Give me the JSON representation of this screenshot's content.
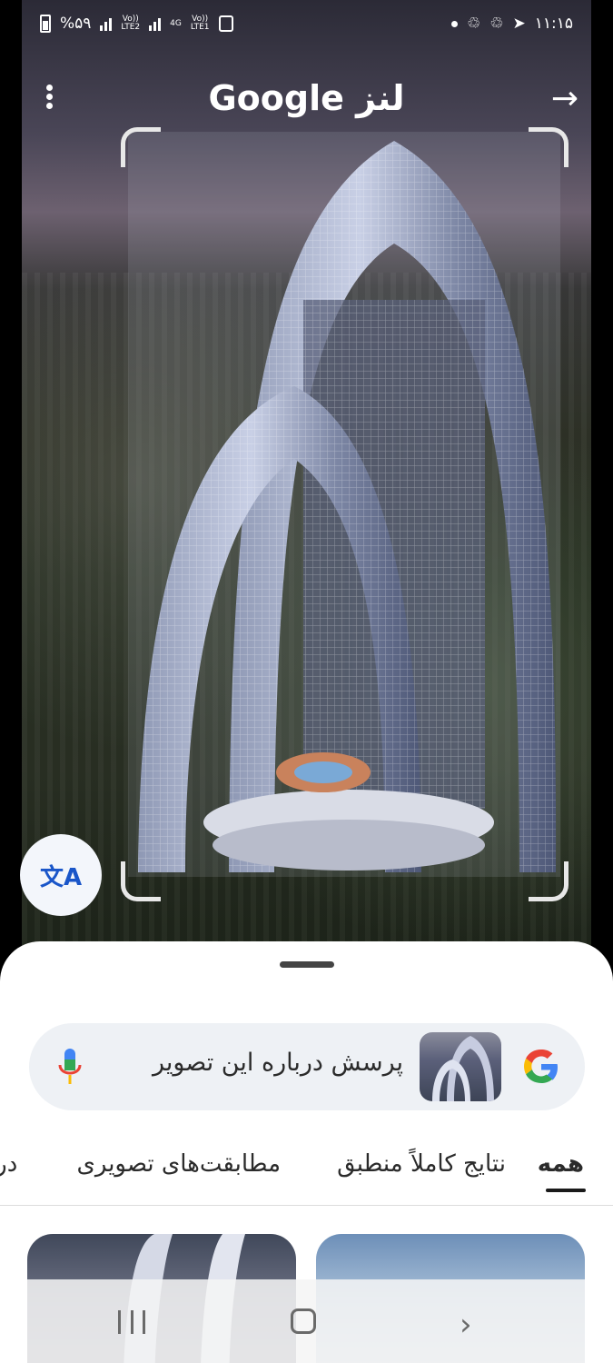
{
  "status_bar": {
    "battery": "%۵۹",
    "sim_labels": [
      "LTE2",
      "LTE1"
    ],
    "volte_label": "Vo))",
    "network_type": "4G",
    "time": "۱۱:۱۵"
  },
  "lens": {
    "title": "Google لنز",
    "menu_icon": "more-vert-icon",
    "forward_icon": "arrow-forward-icon"
  },
  "translate_button": {
    "label": "文A"
  },
  "search": {
    "query": "پرسش درباره این تصویر",
    "mic_icon": "mic-icon",
    "logo_icon": "google-g-icon"
  },
  "tabs": [
    {
      "label": "همه",
      "active": true
    },
    {
      "label": "نتایج کاملاً منطبق",
      "active": false
    },
    {
      "label": "مطابقت‌های تصویری",
      "active": false
    },
    {
      "label": "دربا",
      "active": false
    }
  ],
  "navigation_bar": {
    "recent_icon": "recent-apps-icon",
    "home_icon": "home-icon",
    "back_icon": "back-icon"
  }
}
